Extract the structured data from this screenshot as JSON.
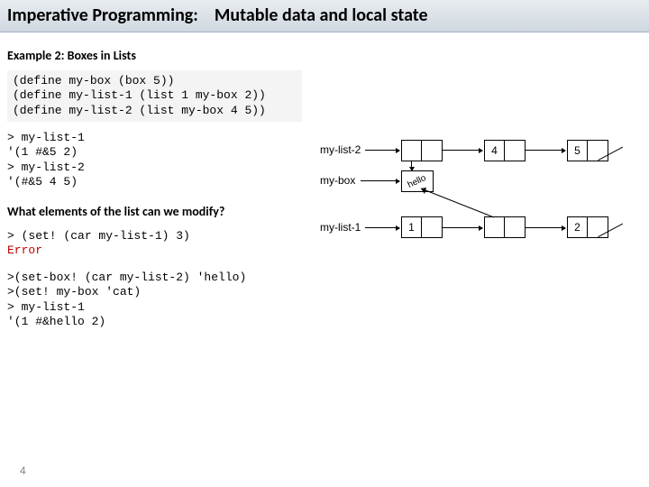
{
  "header": {
    "prefix": "Imperative Programming:",
    "suffix": "Mutable data and local state"
  },
  "exampleTitle": "Example 2: Boxes in Lists",
  "code1": "(define my-box (box 5))\n(define my-list-1 (list 1 my-box 2))\n(define my-list-2 (list my-box 4 5))",
  "code2": {
    "full": "> my-list-1\n'(1 #&5 2)\n> my-list-2\n'(#&5 4 5)"
  },
  "question": "What elements of the list can we modify?",
  "code3": {
    "line1": "> (set! (car my-list-1) 3)",
    "error": "Error"
  },
  "code4": ">(set-box! (car my-list-2) 'hello)\n>(set! my-box 'cat)\n> my-list-1\n'(1 #&hello 2)",
  "slideNumber": "4",
  "diagram": {
    "label_list2": "my-list-2",
    "label_list1": "my-list-1",
    "label_box": "my-box",
    "v4": "4",
    "v5": "5",
    "v1": "1",
    "v2": "2",
    "hello": "hello"
  }
}
